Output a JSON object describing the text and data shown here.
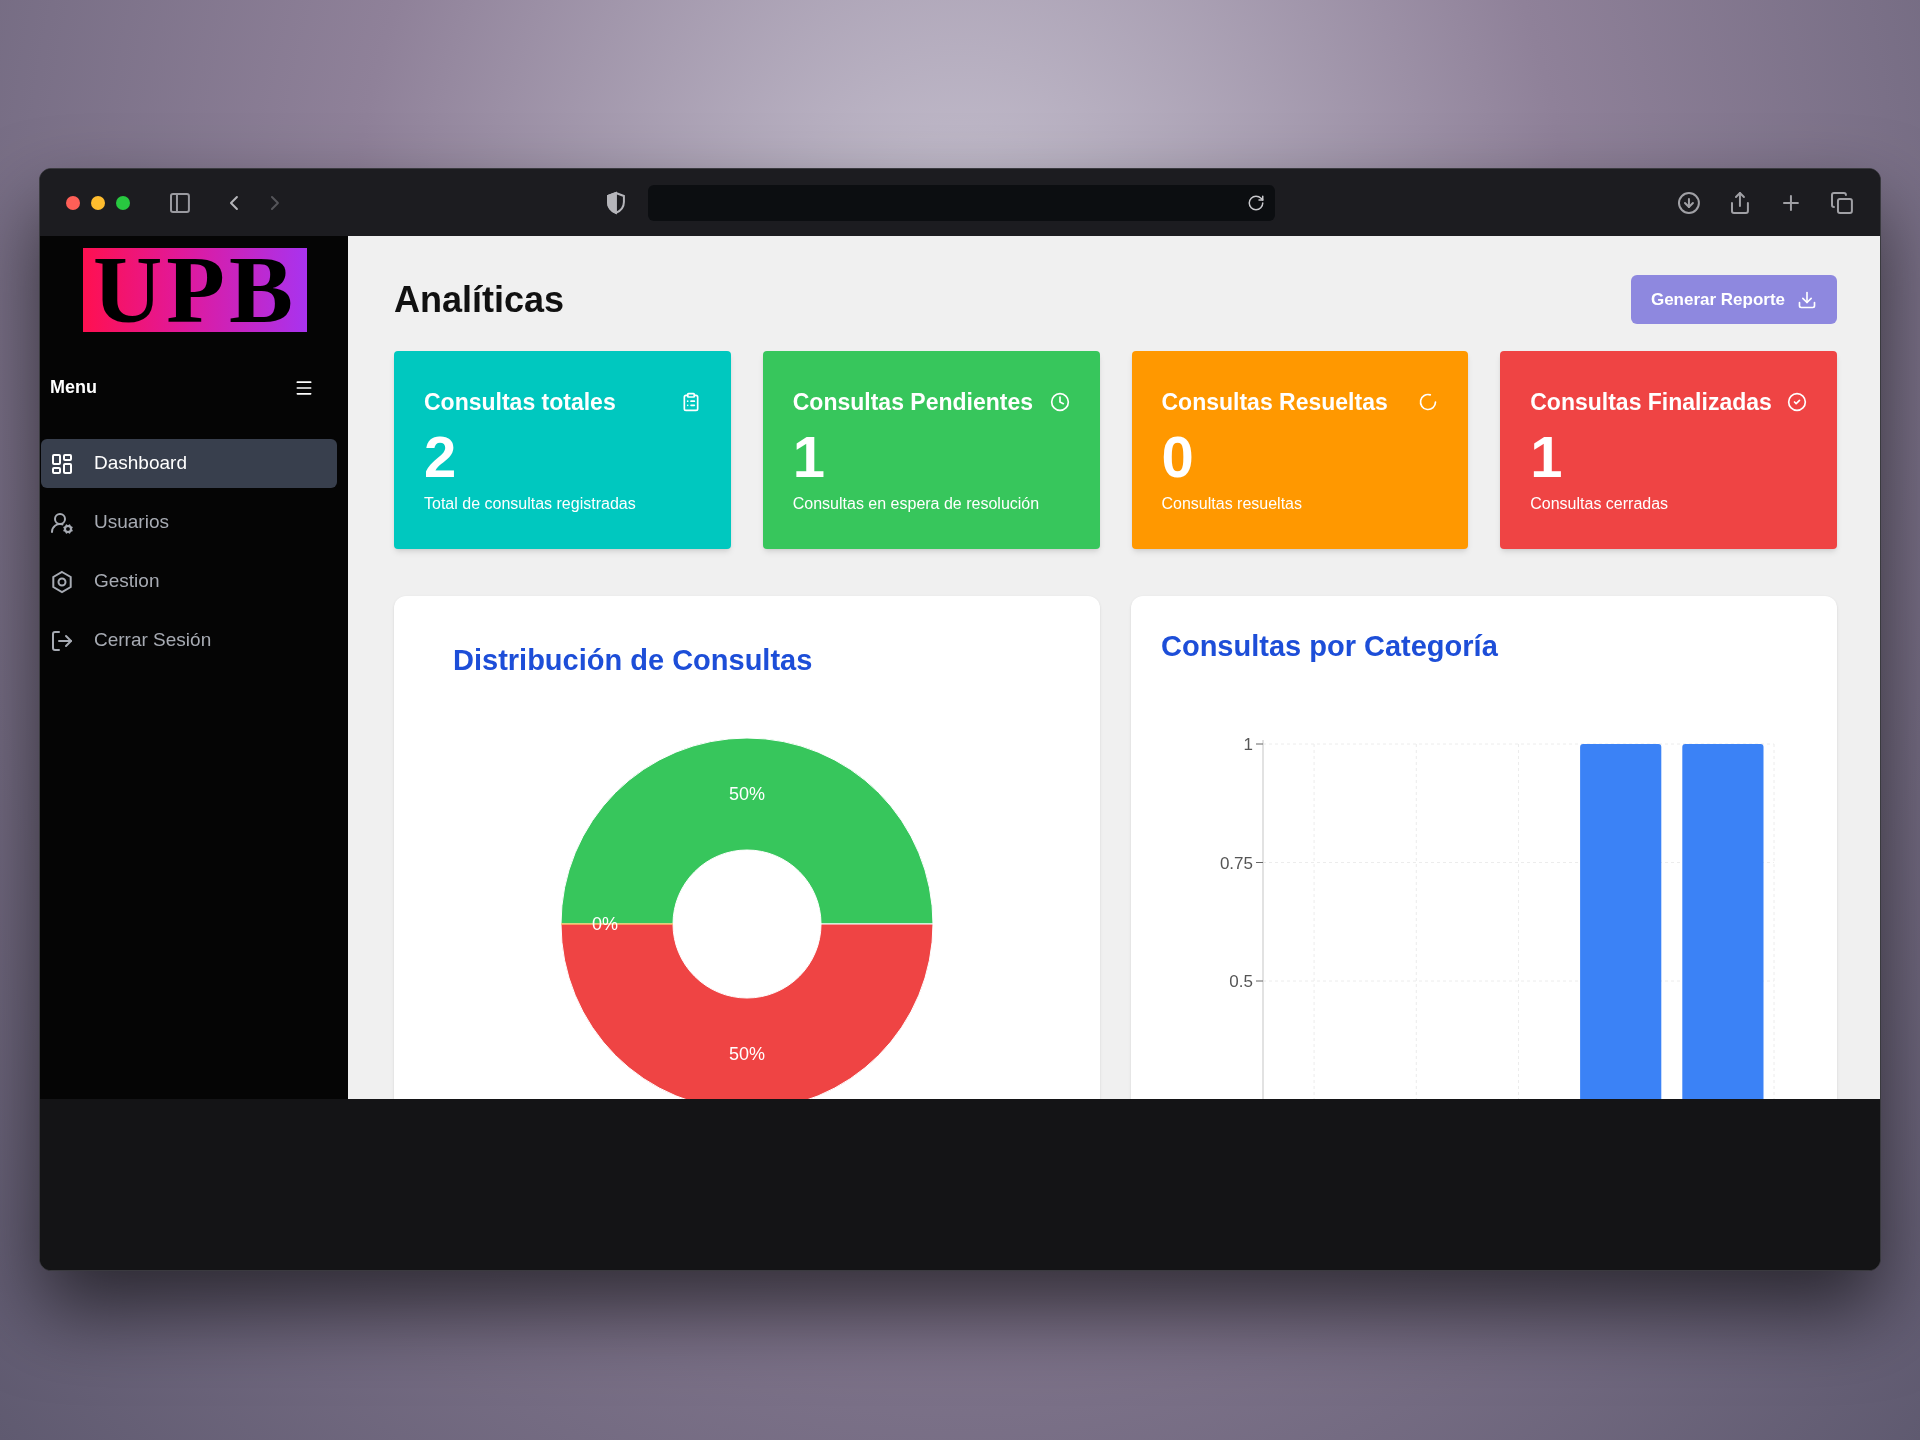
{
  "sidebar": {
    "logo": "UPB",
    "menu_label": "Menu",
    "items": [
      {
        "label": "Dashboard",
        "kind": "dashboard",
        "selected": true
      },
      {
        "label": "Usuarios",
        "kind": "users",
        "selected": false
      },
      {
        "label": "Gestion",
        "kind": "manage",
        "selected": false
      },
      {
        "label": "Cerrar Sesión",
        "kind": "logout",
        "selected": false
      }
    ]
  },
  "page": {
    "title": "Analíticas",
    "report_button": "Generar Reporte"
  },
  "stats": [
    {
      "title": "Consultas totales",
      "value": "2",
      "caption": "Total de consultas registradas",
      "color": "#00c8bf",
      "kind": "clipboard"
    },
    {
      "title": "Consultas Pendientes",
      "value": "1",
      "caption": "Consultas en espera de resolución",
      "color": "#37c65c",
      "kind": "clock"
    },
    {
      "title": "Consultas Resueltas",
      "value": "0",
      "caption": "Consultas resueltas",
      "color": "#ff9800",
      "kind": "loader"
    },
    {
      "title": "Consultas Finalizadas",
      "value": "1",
      "caption": "Consultas cerradas",
      "color": "#ef4444",
      "kind": "check"
    }
  ],
  "distribution": {
    "chart_data": {
      "type": "donut",
      "title": "Distribución de Consultas",
      "values": [
        50,
        50,
        0
      ],
      "colors": [
        "#37c65c",
        "#ef4444",
        "#ff9800"
      ],
      "value_labels": [
        "50%",
        "50%",
        "0%"
      ]
    }
  },
  "by_category": {
    "chart_data": {
      "type": "bar",
      "title": "Consultas por Categoría",
      "grid": true,
      "ylim": [
        0,
        1
      ],
      "series": [
        {
          "color": "#3b82f6",
          "values": [
            0,
            0,
            0,
            1,
            1
          ]
        }
      ],
      "yticks": [
        {
          "value": 0.5,
          "label": "0.5"
        },
        {
          "value": 0.75,
          "label": "0.75"
        },
        {
          "value": 1,
          "label": "1"
        }
      ]
    }
  }
}
